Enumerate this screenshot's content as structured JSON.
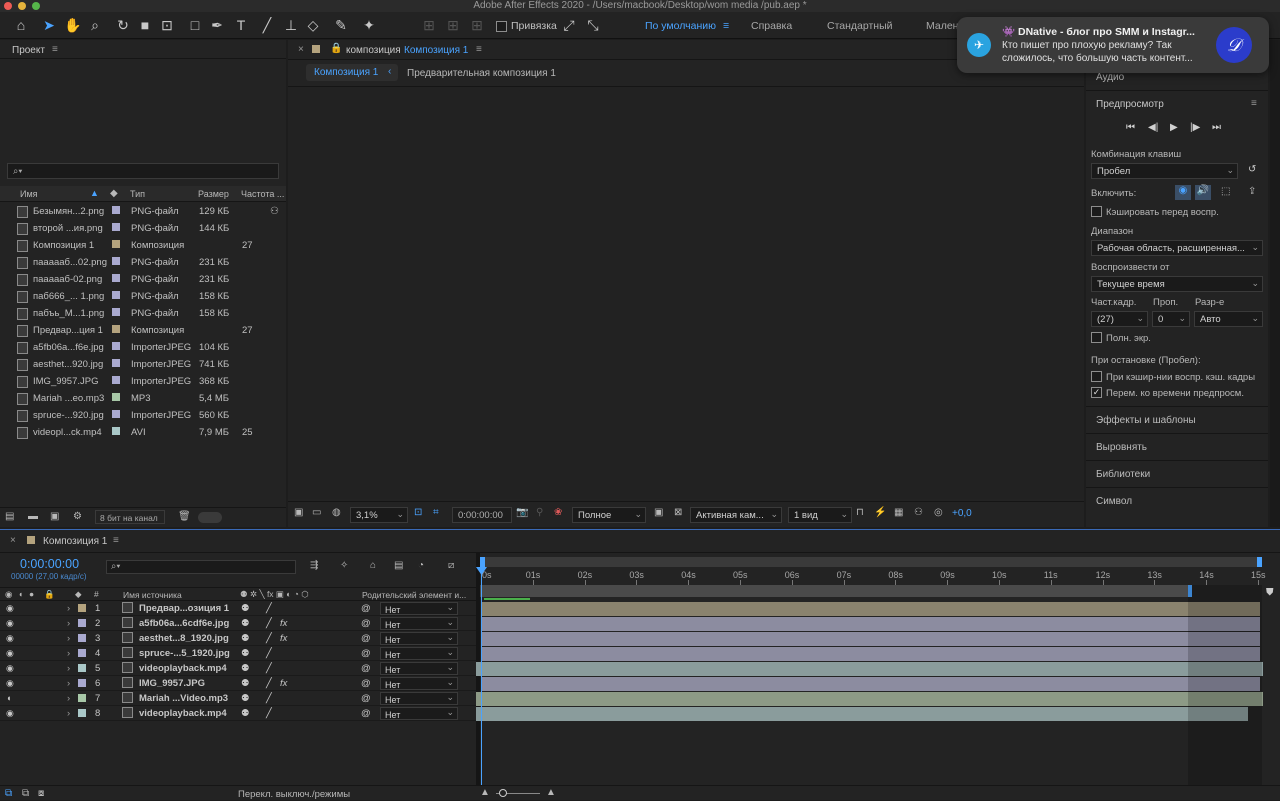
{
  "window": {
    "title": "Adobe After Effects 2020 - /Users/macbook/Desktop/wom media /pub.aep *"
  },
  "toolbar": {
    "snapping_label": "Привязка",
    "workspaces": [
      "По умолчанию",
      "Справка",
      "Стандартный",
      "Мален"
    ]
  },
  "notification": {
    "title": "👾 DNative - блог про SMM и Instagr...",
    "body_line1": "Кто пишет про плохую рекламу? Так",
    "body_line2": "сложилось, что большую часть контент..."
  },
  "project": {
    "title": "Проект",
    "columns": {
      "name": "Имя",
      "type": "Тип",
      "size": "Размер",
      "fps": "Частота ..."
    },
    "items": [
      {
        "name": "Безымян...2.png",
        "type": "PNG-файл",
        "size": "129 КБ",
        "fps": "",
        "color": "#a9a9cf"
      },
      {
        "name": "второй ...ия.png",
        "type": "PNG-файл",
        "size": "144 КБ",
        "fps": "",
        "color": "#a9a9cf"
      },
      {
        "name": "Композиция 1",
        "type": "Композиция",
        "size": "",
        "fps": "27",
        "color": "#b4a37e"
      },
      {
        "name": "пааааaб...02.png",
        "type": "PNG-файл",
        "size": "231 КБ",
        "fps": "",
        "color": "#a9a9cf"
      },
      {
        "name": "пааааaб-02.png",
        "type": "PNG-файл",
        "size": "231 КБ",
        "fps": "",
        "color": "#a9a9cf"
      },
      {
        "name": "паб666_... 1.png",
        "type": "PNG-файл",
        "size": "158 КБ",
        "fps": "",
        "color": "#a9a9cf"
      },
      {
        "name": "пабъь_М...1.png",
        "type": "PNG-файл",
        "size": "158 КБ",
        "fps": "",
        "color": "#a9a9cf"
      },
      {
        "name": "Предвар...ция 1",
        "type": "Композиция",
        "size": "",
        "fps": "27",
        "color": "#b4a37e"
      },
      {
        "name": "a5fb06a...f6e.jpg",
        "type": "ImporterJPEG",
        "size": "104 КБ",
        "fps": "",
        "color": "#a9a9cf"
      },
      {
        "name": "aesthet...920.jpg",
        "type": "ImporterJPEG",
        "size": "741 КБ",
        "fps": "",
        "color": "#a9a9cf"
      },
      {
        "name": "IMG_9957.JPG",
        "type": "ImporterJPEG",
        "size": "368 КБ",
        "fps": "",
        "color": "#a9a9cf"
      },
      {
        "name": "Mariah ...eo.mp3",
        "type": "MP3",
        "size": "5,4 МБ",
        "fps": "",
        "color": "#a7c7a7"
      },
      {
        "name": "spruce-...920.jpg",
        "type": "ImporterJPEG",
        "size": "560 КБ",
        "fps": "",
        "color": "#a9a9cf"
      },
      {
        "name": "videopl...ck.mp4",
        "type": "AVI",
        "size": "7,9 МБ",
        "fps": "25",
        "color": "#a9c7c7"
      }
    ],
    "bit_depth": "8 бит на канал"
  },
  "composition": {
    "tab_label": "композиция",
    "tab_name": "Композиция 1",
    "breadcrumb_active": "Композиция 1",
    "breadcrumb_next": "Предварительная композиция 1",
    "zoom": "3,1%",
    "timecode": "0:00:00:00",
    "resolution": "Полное",
    "camera": "Активная кам...",
    "views": "1 вид",
    "exposure": "+0,0"
  },
  "right": {
    "audio": "Аудио",
    "preview_title": "Предпросмотр",
    "shortcut_label": "Комбинация клавиш",
    "shortcut_value": "Пробел",
    "include_label": "Включить:",
    "cache_before": "Кэшировать перед воспр.",
    "range_label": "Диапазон",
    "range_value": "Рабочая область, расширенная...",
    "play_from_label": "Воспроизвести от",
    "play_from_value": "Текущее время",
    "fps_label": "Част.кадр.",
    "skip_label": "Проп.",
    "res_label": "Разр-е",
    "fps_value": "(27)",
    "skip_value": "0",
    "res_value": "Авто",
    "fullscreen": "Полн. экр.",
    "on_stop_label": "При остановке (Пробел):",
    "on_stop_cache": "При кэшир-нии воспр. кэш. кадры",
    "on_stop_move": "Перем. ко времени предпросм.",
    "sections": [
      "Эффекты и шаблоны",
      "Выровнять",
      "Библиотеки",
      "Символ"
    ]
  },
  "timeline": {
    "tab": "Композиция 1",
    "timecode": "0:00:00:00",
    "frames": "00000 (27,00 кадр/с)",
    "col_num": "#",
    "col_source": "Имя источника",
    "col_parent": "Родительский элемент и...",
    "layers": [
      {
        "num": "1",
        "name": "Предвар...озиция 1",
        "parent": "Нет",
        "color": "#b4a37e",
        "fx": false,
        "bar": "#8a836e"
      },
      {
        "num": "2",
        "name": "a5fb06a...6cdf6e.jpg",
        "parent": "Нет",
        "color": "#a9a9cf",
        "fx": true,
        "bar": "#8c8ca0"
      },
      {
        "num": "3",
        "name": "aesthet...8_1920.jpg",
        "parent": "Нет",
        "color": "#a9a9cf",
        "fx": true,
        "bar": "#8c8ca0"
      },
      {
        "num": "4",
        "name": "spruce-...5_1920.jpg",
        "parent": "Нет",
        "color": "#a9a9cf",
        "fx": false,
        "bar": "#8c8ca0"
      },
      {
        "num": "5",
        "name": "videoplayback.mp4",
        "parent": "Нет",
        "color": "#a9c7c7",
        "fx": false,
        "bar": "#8a9c9c"
      },
      {
        "num": "6",
        "name": "IMG_9957.JPG",
        "parent": "Нет",
        "color": "#a9a9cf",
        "fx": true,
        "bar": "#8c8ca0"
      },
      {
        "num": "7",
        "name": "Mariah ...Video.mp3",
        "parent": "Нет",
        "color": "#a7c7a7",
        "fx": false,
        "bar": "#8d9a86"
      },
      {
        "num": "8",
        "name": "videoplayback.mp4",
        "parent": "Нет",
        "color": "#a9c7c7",
        "fx": false,
        "bar": "#8a9c9c"
      }
    ],
    "ruler": [
      "0s",
      "01s",
      "02s",
      "03s",
      "04s",
      "05s",
      "06s",
      "07s",
      "08s",
      "09s",
      "10s",
      "11s",
      "12s",
      "13s",
      "14s",
      "15s"
    ],
    "footer": "Перекл. выключ./режимы"
  }
}
